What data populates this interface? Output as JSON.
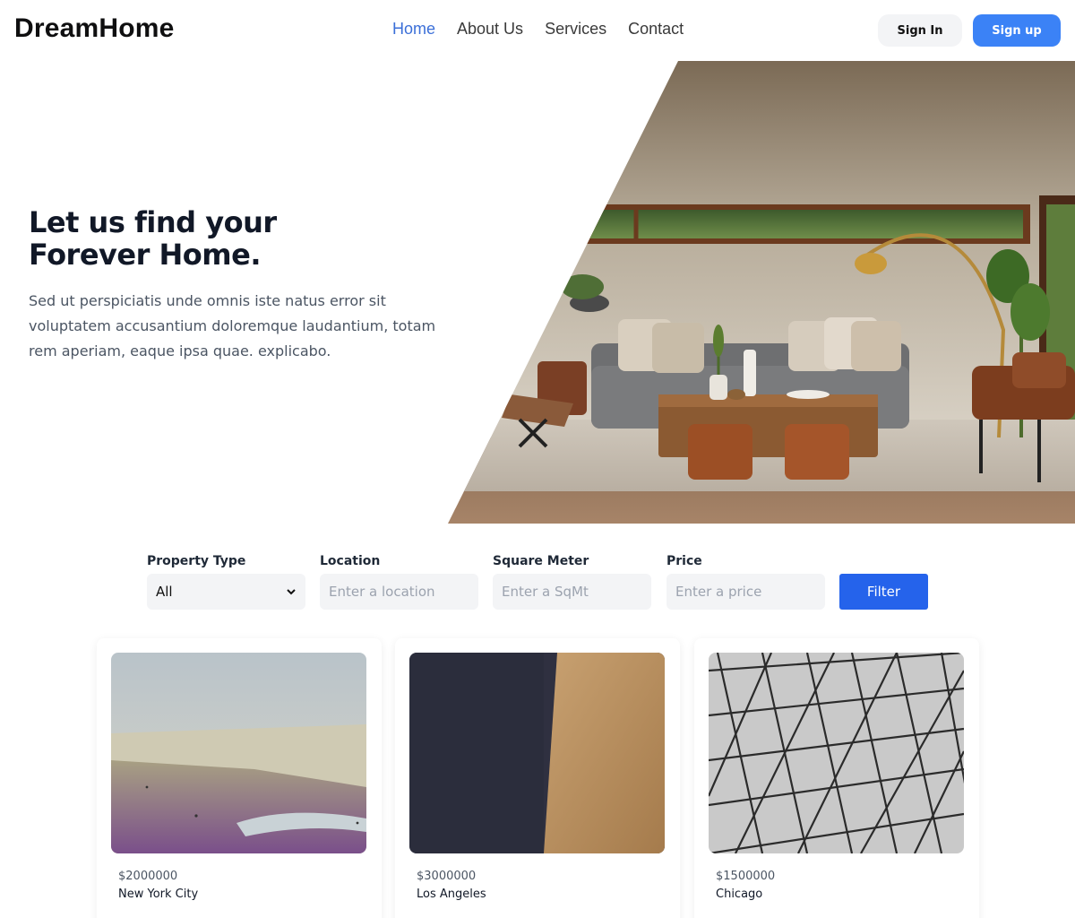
{
  "header": {
    "logo": "DreamHome",
    "nav": [
      {
        "label": "Home",
        "active": true
      },
      {
        "label": "About Us"
      },
      {
        "label": "Services"
      },
      {
        "label": "Contact"
      }
    ],
    "signin_label": "Sign In",
    "signup_label": "Sign up"
  },
  "hero": {
    "title_line1": "Let us find your",
    "title_line2": "Forever Home.",
    "description": "Sed ut perspiciatis unde omnis iste natus error sit voluptatem accusantium doloremque laudantium, totam rem aperiam, eaque ipsa quae. explicabo."
  },
  "filter": {
    "property_type_label": "Property Type",
    "property_type_value": "All",
    "location_label": "Location",
    "location_placeholder": "Enter a location",
    "sqm_label": "Square Meter",
    "sqm_placeholder": "Enter a SqMt",
    "price_label": "Price",
    "price_placeholder": "Enter a price",
    "button_label": "Filter"
  },
  "listings": [
    {
      "price": "$2000000",
      "city": "New York City"
    },
    {
      "price": "$3000000",
      "city": "Los Angeles"
    },
    {
      "price": "$1500000",
      "city": "Chicago"
    }
  ],
  "colors": {
    "accent": "#3b82f6",
    "nav_active": "#3b6fd8",
    "filter_button": "#2563eb"
  }
}
